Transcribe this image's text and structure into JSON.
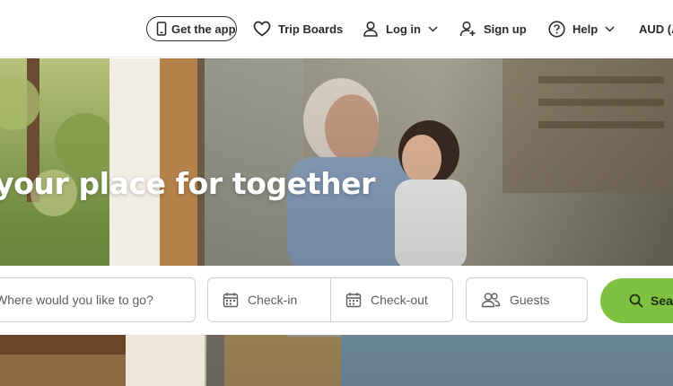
{
  "nav": {
    "get_app": "Get the app",
    "trip_boards": "Trip Boards",
    "login": "Log in",
    "signup": "Sign up",
    "help": "Help",
    "currency": "AUD (A"
  },
  "hero": {
    "title": "your place for together"
  },
  "search": {
    "destination_placeholder": "Where would you like to go?",
    "checkin": "Check-in",
    "checkout": "Check-out",
    "guests": "Guests",
    "button": "Search"
  },
  "colors": {
    "accent_green": "#7fc241",
    "text_dark": "#2b2b2b"
  }
}
